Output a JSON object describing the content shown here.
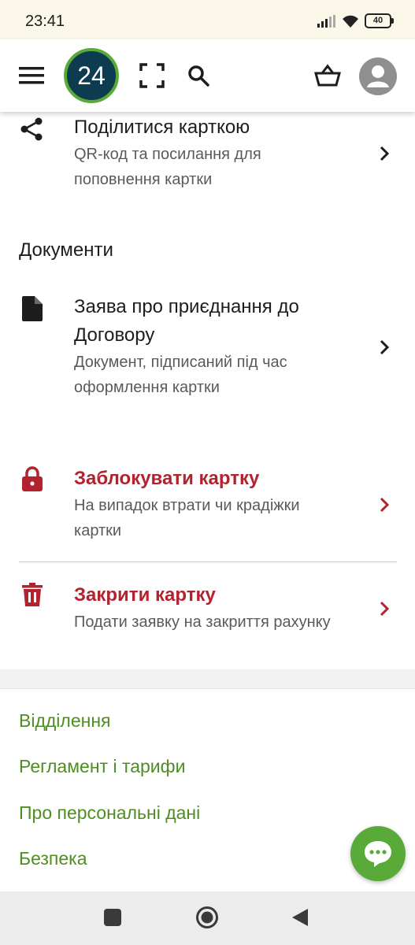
{
  "status_bar": {
    "time": "23:41",
    "battery": "40"
  },
  "header": {
    "logo_text": "24"
  },
  "share": {
    "title": "Поділитися карткою",
    "subtitle_line1": "QR-код та посилання для",
    "subtitle_line2": "поповнення картки"
  },
  "documents": {
    "heading": "Документи",
    "item": {
      "title_line1": "Заява про приєднання до",
      "title_line2": "Договору",
      "subtitle_line1": "Документ, підписаний під час",
      "subtitle_line2": "оформлення картки"
    }
  },
  "block_card": {
    "title": "Заблокувати картку",
    "subtitle_line1": "На випадок втрати чи крадіжки",
    "subtitle_line2": "картки"
  },
  "close_card": {
    "title": "Закрити картку",
    "subtitle": "Подати заявку на закриття рахунку"
  },
  "footer_links": [
    "Відділення",
    "Регламент і тарифи",
    "Про персональні дані",
    "Безпека"
  ],
  "colors": {
    "accent_green": "#5aaa3a",
    "link_green": "#4d8d22",
    "danger_red": "#b3232f",
    "logo_navy": "#0d3b4f"
  },
  "icons": {
    "header": [
      "menu-icon",
      "scan-icon",
      "search-icon",
      "basket-icon",
      "avatar-icon"
    ],
    "rows": [
      "share-icon",
      "document-icon",
      "lock-icon",
      "trash-icon",
      "chevron-right-icon"
    ],
    "fab": "chat-icon",
    "nav": [
      "recent-apps-icon",
      "home-icon",
      "back-icon"
    ]
  }
}
